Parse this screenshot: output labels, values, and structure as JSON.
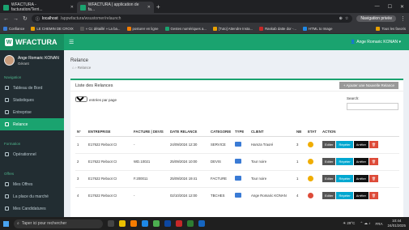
{
  "browser": {
    "tabs": [
      {
        "label": "WFACTURA - facturation/Terri..."
      },
      {
        "label": "WFACTURA | application de fa..."
      }
    ],
    "url_host": "localhost",
    "url_path": "/appwfactura/wsustomer/relaunch",
    "private_label": "Navigation privée",
    "bookmarks": [
      "Confiance",
      "LE CHEMIN DE CROIX",
      "« Cc détaillé » La ba...",
      "posturer en ligne",
      "Gestes numériques a...",
      "[Tuto] Attendre Insta...",
      "Raskab datte dor -...",
      "HTML to Image",
      "Tous les favoris"
    ]
  },
  "app": {
    "brand": "WFACTURA",
    "user_top": "Ange Romaric KONAN"
  },
  "sidebar": {
    "user_name": "Ange Romaric KONAN",
    "user_role": "Gérant",
    "sections": [
      {
        "title": "Navigation",
        "items": [
          {
            "label": "Tableau de Bord",
            "active": false
          },
          {
            "label": "Statistiques",
            "active": false
          },
          {
            "label": "Entreprise",
            "active": false
          },
          {
            "label": "Relance",
            "active": true
          }
        ]
      },
      {
        "title": "Formation",
        "items": [
          {
            "label": "Opérationnel",
            "active": false
          }
        ]
      },
      {
        "title": "Offres",
        "items": [
          {
            "label": "Mes Offres",
            "active": false
          },
          {
            "label": "La place du marché",
            "active": false
          },
          {
            "label": "Mes Candidatures",
            "active": false
          }
        ]
      }
    ]
  },
  "page": {
    "title": "Relance",
    "breadcrumb": "Relance",
    "box_title": "Liste des Relances",
    "add_button": "+ Ajouter une Nouvelle Relance",
    "show_count": "10",
    "entries_label": "entrées par page",
    "search_label": "Search:"
  },
  "table": {
    "headers": [
      "N°",
      "ENTREPRISE",
      "FACTURE | DEVIS",
      "DATE RELANCE",
      "CATEGORIE",
      "TYPE",
      "CLIENT",
      "NB",
      "ETAT",
      "ACTION"
    ],
    "action_labels": {
      "edit": "Editer",
      "repeat": "Répéter",
      "stop": "Arrêter"
    },
    "rows": [
      {
        "n": "1",
        "entreprise": "E17622 Reboot CI",
        "doc": "-",
        "date": "24/09/2024 12:30",
        "cat": "SERVICE",
        "client": "Hamza Traoré",
        "nb": "3",
        "etat_color": "#f0ad00"
      },
      {
        "n": "2",
        "entreprise": "E17622 Reboot CI",
        "doc": "WD.10021",
        "date": "25/09/2024 10:00",
        "cat": "DEVIS",
        "client": "Tour noire",
        "nb": "1",
        "etat_color": "#f0ad00"
      },
      {
        "n": "3",
        "entreprise": "E17622 Reboot CI",
        "doc": "F.200011",
        "date": "25/09/2024 19:41",
        "cat": "FACTURE",
        "client": "Tour noire",
        "nb": "1",
        "etat_color": "#f0ad00"
      },
      {
        "n": "4",
        "entreprise": "E17622 Reboot CI",
        "doc": "-",
        "date": "02/10/2024 12:00",
        "cat": "TBCHES",
        "client": "Ange Romaric KONAN",
        "nb": "4",
        "etat_color": "#dd4b39"
      }
    ]
  },
  "taskbar": {
    "search_placeholder": "Taper ici pour rechercher",
    "weather": "29°C",
    "lang": "FRA",
    "time": "10:44",
    "date": "24/01/2025"
  },
  "colors": {
    "brand": "#1aa36f",
    "sidebar": "#222d32",
    "edit": "#555555",
    "repeat": "#00a7d0",
    "stop": "#111111",
    "delete": "#dd4b39"
  }
}
